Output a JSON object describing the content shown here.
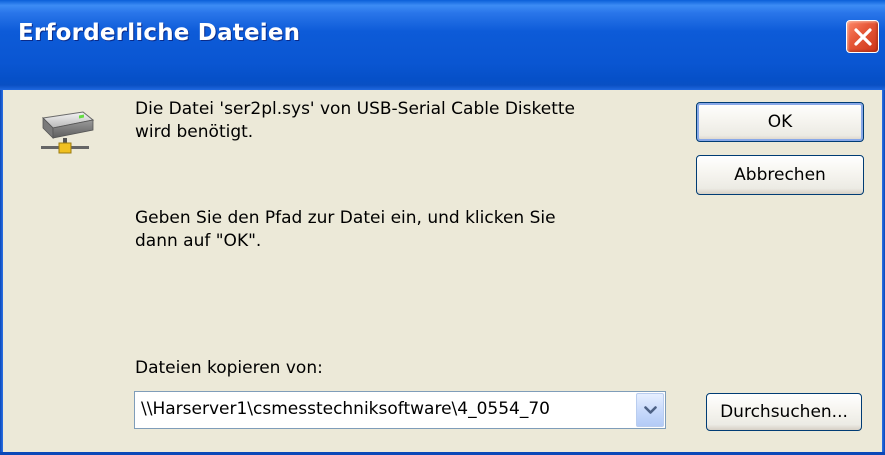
{
  "window": {
    "title": "Erforderliche Dateien",
    "close_icon": "close-x-icon"
  },
  "dialog": {
    "icon": "network-drive-icon",
    "message_line1": "Die Datei 'ser2pl.sys' von USB-Serial Cable Diskette",
    "message_line2": "wird benötigt.",
    "instruction_line1": "Geben Sie den Pfad zur Datei ein, und klicken Sie",
    "instruction_line2": "dann auf \"OK\".",
    "copy_from_label": "Dateien kopieren von:",
    "copy_from_value": "\\\\Harserver1\\csmesstechniksoftware\\4_0554_70",
    "dropdown_icon": "chevron-down-icon"
  },
  "buttons": {
    "ok": "OK",
    "cancel": "Abbrechen",
    "browse": "Durchsuchen..."
  },
  "colors": {
    "titlebar": "#0a56d2",
    "dialog_background": "#ece9d8",
    "close_button": "#e75a3a"
  }
}
